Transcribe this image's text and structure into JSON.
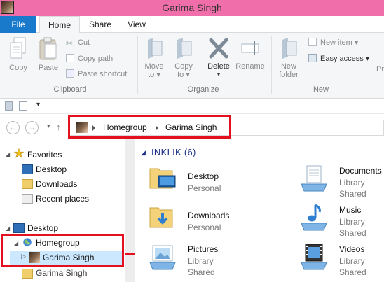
{
  "window": {
    "title": "Garima Singh"
  },
  "tabs": {
    "file": "File",
    "home": "Home",
    "share": "Share",
    "view": "View"
  },
  "ribbon": {
    "clipboard": {
      "copy": "Copy",
      "paste": "Paste",
      "cut": "Cut",
      "copy_path": "Copy path",
      "paste_shortcut": "Paste shortcut",
      "group": "Clipboard"
    },
    "organize": {
      "move_to_1": "Move",
      "move_to_2": "to",
      "copy_to_1": "Copy",
      "copy_to_2": "to",
      "delete": "Delete",
      "rename": "Rename",
      "group": "Organize"
    },
    "new": {
      "new_folder_1": "New",
      "new_folder_2": "folder",
      "new_item": "New item",
      "easy_access": "Easy access",
      "group": "New"
    },
    "cut_off": "Pr"
  },
  "address": {
    "crumbs": [
      "Homegroup",
      "Garima Singh"
    ]
  },
  "nav": {
    "favorites": "Favorites",
    "desktop": "Desktop",
    "downloads": "Downloads",
    "recent": "Recent places",
    "desktop2": "Desktop",
    "homegroup": "Homegroup",
    "user": "Garima Singh",
    "user2": "Garima Singh"
  },
  "content": {
    "group_header": "INKLIK (6)",
    "items": [
      {
        "name": "Desktop",
        "sub1": "Personal",
        "sub2": ""
      },
      {
        "name": "Documents",
        "sub1": "Library",
        "sub2": "Shared"
      },
      {
        "name": "Downloads",
        "sub1": "Personal",
        "sub2": ""
      },
      {
        "name": "Music",
        "sub1": "Library",
        "sub2": "Shared"
      },
      {
        "name": "Pictures",
        "sub1": "Library",
        "sub2": "Shared"
      },
      {
        "name": "Videos",
        "sub1": "Library",
        "sub2": "Shared"
      }
    ]
  },
  "colors": {
    "titlebar": "#f06ea9",
    "file_tab": "#1979ca",
    "highlight": "#e3101f",
    "selection": "#cce8ff"
  }
}
